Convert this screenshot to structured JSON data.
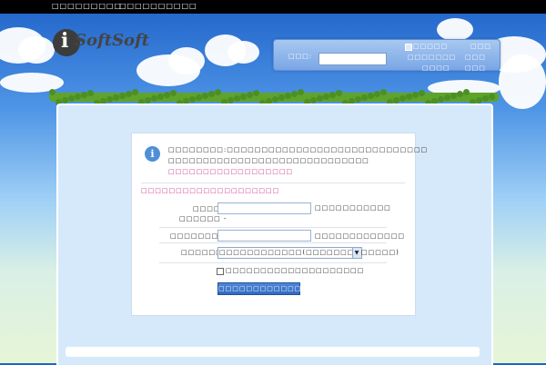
{
  "topbar": {
    "link1": "□□□□□□□□□",
    "link2": "□□□□□□□□□□"
  },
  "logo": {
    "initial": "i",
    "text": "SoftSoft"
  },
  "login": {
    "label": "□□□:",
    "remember": "□□□□□",
    "link_a": "□□□",
    "link_b": "□□□□□□□",
    "link_c": "□□□",
    "link_d": "□□□□",
    "link_e": "□□□"
  },
  "main": {
    "info_icon": "i",
    "message_line1": "□□□□□□□□:□□□□□□□□□□□□□□□□□□□□□□□□□□□□□",
    "message_line2": "□□□□□□□□□□□□□□□□□□□□□□□□□□□□□",
    "message_link": "□□□□□□□□□□□□□□□□□□",
    "section_title": "□□□□□□□□□□□□□□□□□□□□",
    "field1_label": "□□□□",
    "field1_hint": "□□□□□□□□□□□",
    "field1_hint2": "□□□□□□ -",
    "field2_label": "□□□□□□□□:",
    "field2_hint": "□□□□□□□□□□□□□",
    "field3_label": "□□□□□□:",
    "select_value": "□□□□□□□□□□□□(□□□□□□□□□□□□□)",
    "checkbox_label": "□□□□□□□□□□□□□□□□□□□□",
    "submit_label": "□□□□□□□□□□□□□□"
  }
}
